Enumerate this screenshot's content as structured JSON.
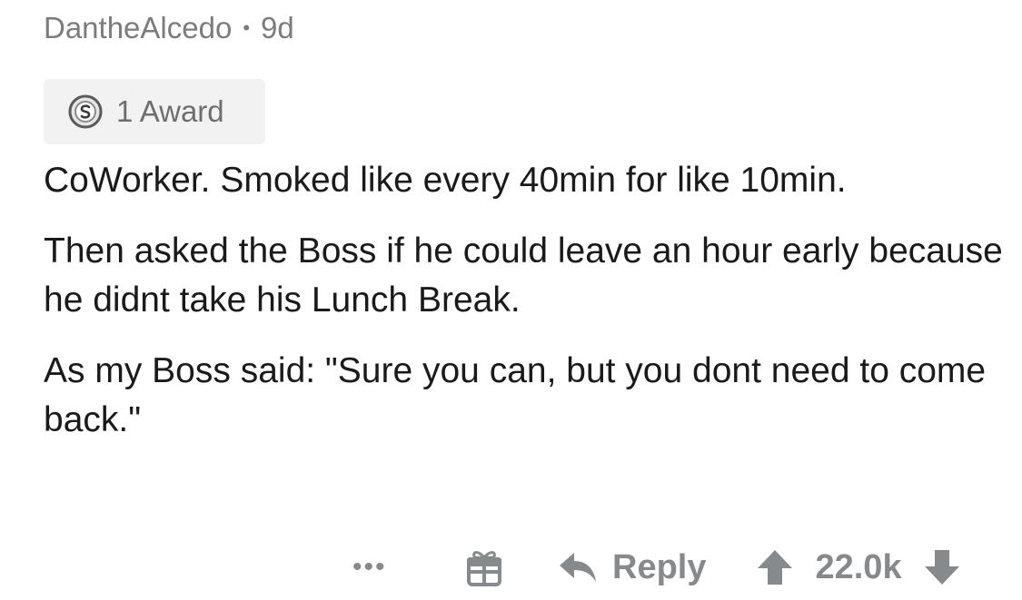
{
  "comment": {
    "author": "DantheAlcedo",
    "separator": "•",
    "age": "9d",
    "award_label": "1 Award",
    "paragraphs": [
      "CoWorker. Smoked like every 40min for like 10min.",
      "Then asked the Boss if he could leave an hour early because he didnt take his Lunch Break.",
      "As my Boss said: \"Sure you can, but you dont need to come back.\""
    ]
  },
  "actions": {
    "more_label": "•••",
    "reply_label": "Reply",
    "score": "22.0k"
  },
  "icons": {
    "award": "silver-award-icon",
    "gift": "gift-icon",
    "reply": "reply-arrow-icon",
    "upvote": "upvote-arrow-icon",
    "downvote": "downvote-arrow-icon"
  },
  "colors": {
    "meta_text": "#7c7c7c",
    "action_gray": "#878a8c",
    "award_bg": "#f2f2f2",
    "body_text": "#1a1a1b"
  }
}
